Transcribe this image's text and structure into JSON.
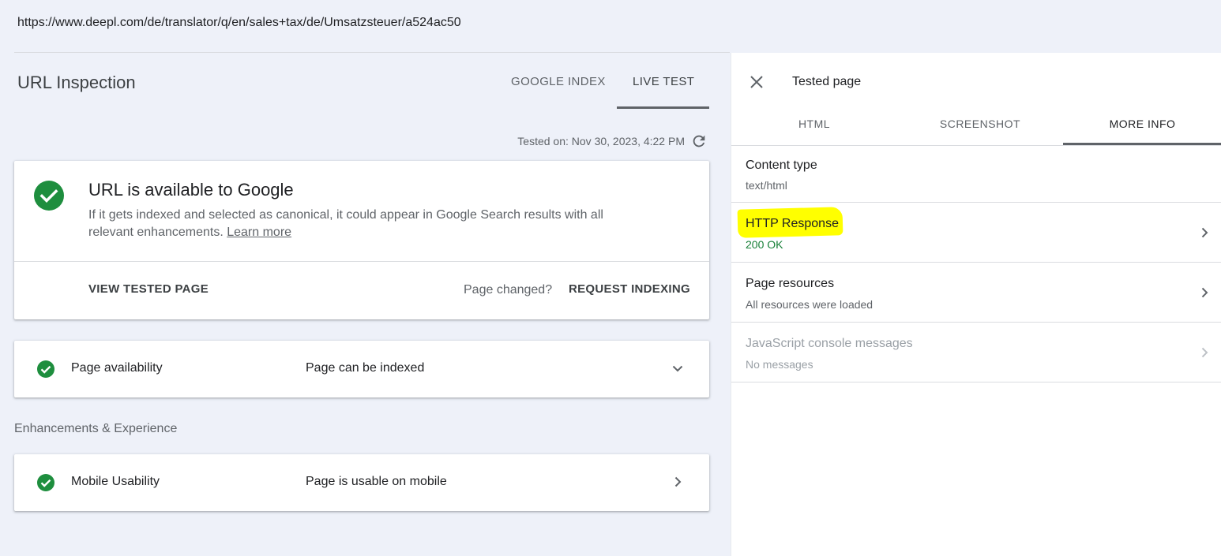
{
  "browser": {
    "url": "https://www.deepl.com/de/translator/q/en/sales+tax/de/Umsatzsteuer/a524ac50"
  },
  "inspection": {
    "title": "URL Inspection",
    "tabs": {
      "google_index": "GOOGLE INDEX",
      "live_test": "LIVE TEST"
    },
    "active_tab": "LIVE TEST",
    "tested_on": "Tested on: Nov 30, 2023, 4:22 PM",
    "status_card": {
      "title": "URL is available to Google",
      "description": "If it gets indexed and selected as canonical, it could appear in Google Search results with all relevant enhancements.",
      "learn_more": "Learn more",
      "view_tested_page": "VIEW TESTED PAGE",
      "page_changed": "Page changed?",
      "request_indexing": "REQUEST INDEXING"
    },
    "availability": {
      "label": "Page availability",
      "value": "Page can be indexed"
    },
    "enhancements_heading": "Enhancements & Experience",
    "mobile": {
      "label": "Mobile Usability",
      "value": "Page is usable on mobile"
    }
  },
  "panel": {
    "title": "Tested page",
    "tabs": {
      "html": "HTML",
      "screenshot": "SCREENSHOT",
      "more_info": "MORE INFO"
    },
    "active_tab": "MORE INFO",
    "rows": {
      "content_type": {
        "title": "Content type",
        "value": "text/html"
      },
      "http_response": {
        "title": "HTTP Response",
        "value": "200 OK",
        "highlighted": true
      },
      "page_resources": {
        "title": "Page resources",
        "value": "All resources were loaded"
      },
      "js_console": {
        "title": "JavaScript console messages",
        "value": "No messages"
      }
    }
  },
  "colors": {
    "success_green": "#1e8e3e",
    "ok_text_green": "#188038",
    "highlight_yellow": "#ffff00",
    "background": "#eef1f9"
  },
  "icons": [
    "check-circle-icon",
    "refresh-icon",
    "chevron-down-icon",
    "chevron-right-icon",
    "close-icon"
  ]
}
